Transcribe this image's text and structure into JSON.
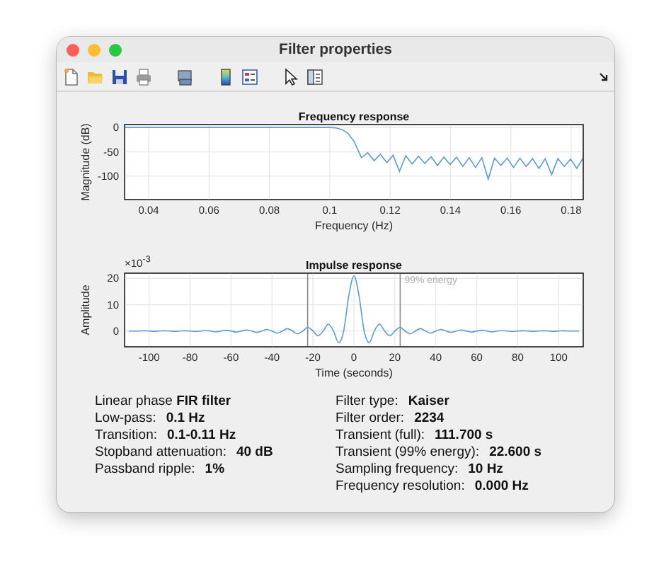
{
  "window": {
    "title": "Filter properties"
  },
  "frequency_response": {
    "chart_data": {
      "type": "line",
      "title": "Frequency response",
      "xlabel": "Frequency (Hz)",
      "ylabel": "Magnitude (dB)",
      "xlim": [
        0.032,
        0.184
      ],
      "ylim": [
        -148,
        6
      ],
      "xticks": [
        {
          "value": 0.04,
          "label": "0.04"
        },
        {
          "value": 0.06,
          "label": "0.06"
        },
        {
          "value": 0.08,
          "label": "0.08"
        },
        {
          "value": 0.1,
          "label": "0.1"
        },
        {
          "value": 0.12,
          "label": "0.12"
        },
        {
          "value": 0.14,
          "label": "0.14"
        },
        {
          "value": 0.16,
          "label": "0.16"
        },
        {
          "value": 0.18,
          "label": "0.18"
        }
      ],
      "yticks": [
        {
          "value": 0,
          "label": "0"
        },
        {
          "value": -50,
          "label": "-50"
        },
        {
          "value": -100,
          "label": "-100"
        }
      ],
      "x": [
        0.032,
        0.1,
        0.102,
        0.104,
        0.106,
        0.108,
        0.1105,
        0.1126,
        0.1147,
        0.1168,
        0.1189,
        0.121,
        0.1231,
        0.1252,
        0.1273,
        0.1294,
        0.1315,
        0.1336,
        0.1357,
        0.1378,
        0.1399,
        0.142,
        0.1441,
        0.1462,
        0.1483,
        0.1504,
        0.1525,
        0.1546,
        0.1567,
        0.1588,
        0.1609,
        0.163,
        0.1651,
        0.1672,
        0.1693,
        0.1714,
        0.1735,
        0.1756,
        0.1777,
        0.1798,
        0.1819,
        0.184
      ],
      "grid": true,
      "series": [
        {
          "color": "#5b9bd5",
          "values": [
            0,
            0,
            -1,
            -4,
            -12,
            -28,
            -62,
            -52,
            -68,
            -55,
            -72,
            -57,
            -90,
            -58,
            -75,
            -59,
            -74,
            -60,
            -78,
            -61,
            -76,
            -61,
            -80,
            -62,
            -82,
            -62,
            -106,
            -63,
            -78,
            -63,
            -82,
            -63,
            -80,
            -64,
            -84,
            -64,
            -97,
            -64,
            -80,
            -65,
            -84,
            -62
          ]
        }
      ]
    }
  },
  "impulse_response": {
    "multiplier": "×10$^{-3}$",
    "chart_data": {
      "type": "line",
      "title": "Impulse response",
      "xlabel": "Time (seconds)",
      "ylabel": "Amplitude",
      "xlim": [
        -112,
        112
      ],
      "ylim": [
        -6,
        22
      ],
      "xticks": [
        {
          "value": -100,
          "label": "-100"
        },
        {
          "value": -80,
          "label": "-80"
        },
        {
          "value": -60,
          "label": "-60"
        },
        {
          "value": -40,
          "label": "-40"
        },
        {
          "value": -20,
          "label": "-20"
        },
        {
          "value": 0,
          "label": "0"
        },
        {
          "value": 20,
          "label": "20"
        },
        {
          "value": 40,
          "label": "40"
        },
        {
          "value": 60,
          "label": "60"
        },
        {
          "value": 80,
          "label": "80"
        },
        {
          "value": 100,
          "label": "100"
        }
      ],
      "yticks": [
        {
          "value": 0,
          "label": "0"
        },
        {
          "value": 10,
          "label": "10"
        },
        {
          "value": 20,
          "label": "20"
        }
      ],
      "grid": true,
      "ref_lines": [
        {
          "axis": "x",
          "value": -22.6
        },
        {
          "axis": "x",
          "value": 22.6
        }
      ],
      "annotations": [
        "99% energy"
      ],
      "x": [
        -110,
        -107.5,
        -105,
        -102.5,
        -100,
        -97.5,
        -95,
        -92.5,
        -90,
        -87.5,
        -85,
        -82.5,
        -80,
        -77.5,
        -75,
        -72.5,
        -70,
        -67.5,
        -65,
        -62.5,
        -60,
        -57.5,
        -55,
        -52.5,
        -50,
        -47.5,
        -45,
        -42.5,
        -40,
        -37.5,
        -35,
        -32.5,
        -30,
        -27.5,
        -25,
        -22.5,
        -20,
        -17.5,
        -15,
        -12.5,
        -10,
        -7.5,
        -5,
        -2.5,
        0,
        2.5,
        5,
        7.5,
        10,
        12.5,
        15,
        17.5,
        20,
        22.5,
        25,
        27.5,
        30,
        32.5,
        35,
        37.5,
        40,
        42.5,
        45,
        47.5,
        50,
        52.5,
        55,
        57.5,
        60,
        62.5,
        65,
        67.5,
        70,
        72.5,
        75,
        77.5,
        80,
        82.5,
        85,
        87.5,
        90,
        92.5,
        95,
        97.5,
        100,
        102.5,
        105,
        107.5,
        110
      ],
      "series": [
        {
          "color": "#5b9bd5",
          "values": [
            0,
            0,
            0,
            0.1,
            0,
            -0.1,
            0,
            0.1,
            0,
            -0.1,
            0,
            0.1,
            0,
            -0.2,
            0,
            0.2,
            0,
            -0.3,
            0,
            0.3,
            0,
            -0.4,
            0,
            0.4,
            0,
            -0.5,
            0,
            0.6,
            0,
            -0.8,
            0,
            0.9,
            0,
            -1.1,
            0,
            1.4,
            0,
            -1.8,
            0,
            2.6,
            0,
            -4.4,
            0,
            13.4,
            21,
            13.4,
            0,
            -4.4,
            0,
            2.6,
            0,
            -1.8,
            0,
            1.4,
            0,
            -1.1,
            0,
            0.9,
            0,
            -0.8,
            0,
            0.6,
            0,
            -0.5,
            0,
            0.4,
            0,
            -0.4,
            0,
            0.3,
            0,
            -0.3,
            0,
            0.2,
            0,
            -0.2,
            0,
            0.1,
            0,
            -0.1,
            0,
            0.1,
            0,
            -0.1,
            0,
            0.1,
            0,
            0,
            0
          ]
        }
      ]
    }
  },
  "info_left": [
    {
      "kind": "sentence",
      "text": "Linear phase **FIR filter**"
    },
    {
      "kind": "field",
      "label": "Low-pass:",
      "value": "0.1 Hz"
    },
    {
      "kind": "field",
      "label": "Transition:",
      "value": "0.1-0.11 Hz"
    },
    {
      "kind": "field",
      "label": "Stopband attenuation:",
      "value": "40 dB"
    },
    {
      "kind": "field",
      "label": "Passband ripple:",
      "value": "1%"
    }
  ],
  "info_right": [
    {
      "kind": "field",
      "label": "Filter type:",
      "value": "Kaiser"
    },
    {
      "kind": "field",
      "label": "Filter order:",
      "value": "2234"
    },
    {
      "kind": "field",
      "label": "Transient (full):",
      "value": "111.700 s"
    },
    {
      "kind": "field",
      "label": "Transient (99% energy):",
      "value": "22.600 s"
    },
    {
      "kind": "field",
      "label": "Sampling frequency:",
      "value": "10 Hz"
    },
    {
      "kind": "field",
      "label": "Frequency resolution:",
      "value": "0.000 Hz"
    }
  ]
}
